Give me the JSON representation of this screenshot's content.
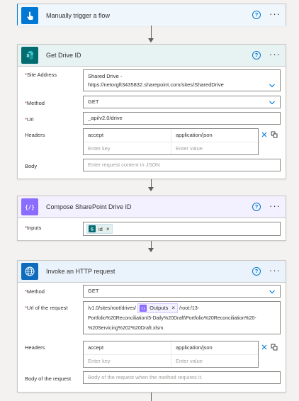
{
  "cards": {
    "trigger": {
      "title": "Manually trigger a flow"
    },
    "drive": {
      "title": "Get Drive ID",
      "site_address_label": "Site Address",
      "site_address_line1": "Shared Drive -",
      "site_address_line2": "https://netorgft3435832.sharepoint.com/sites/SharedDrive",
      "method_label": "Method",
      "method_value": "GET",
      "uri_label": "Uri",
      "uri_value": "_api/v2.0/drive",
      "headers_label": "Headers",
      "header_key": "accept",
      "header_value": "application/json",
      "key_placeholder": "Enter key",
      "value_placeholder": "Enter value",
      "body_label": "Body",
      "body_placeholder": "Enter request content in JSON"
    },
    "compose": {
      "title": "Compose SharePoint Drive ID",
      "inputs_label": "Inputs",
      "token_label": "id"
    },
    "http": {
      "title": "Invoke an HTTP request",
      "method_label": "Method",
      "method_value": "GET",
      "url_label": "Url of the request",
      "url_prefix": "/v1.0/sites/root/drives/",
      "url_token": "Outputs",
      "url_suffix": "/root:/13-",
      "url_line2": "Portfolio%20Reconciliation\\5-Daily%20Draft\\Portfolio%20Reconciliation%20-",
      "url_line3": "%20Servicing%202%20Draft.xlsm",
      "headers_label": "Headers",
      "header_key": "accept",
      "header_value": "application/json",
      "key_placeholder": "Enter key",
      "value_placeholder": "Enter value",
      "body_label": "Body of the request",
      "body_placeholder": "Body of the request when the method requires it."
    }
  },
  "symbols": {
    "help": "?",
    "more": "···",
    "required": "*",
    "remove": "×",
    "compose": "{/}"
  },
  "colors": {
    "trigger_accent": "#0078d4",
    "sharepoint_accent": "#036c70",
    "compose_accent": "#8c6cff",
    "http_accent": "#0f6cbd",
    "connector_accent": "#605e5c"
  },
  "icons": [
    "touch-icon",
    "sharepoint-icon",
    "compose-icon",
    "globe-icon",
    "help-icon",
    "more-icon",
    "chevron-down-icon",
    "close-icon",
    "switch-mode-icon",
    "down-arrow-icon"
  ]
}
